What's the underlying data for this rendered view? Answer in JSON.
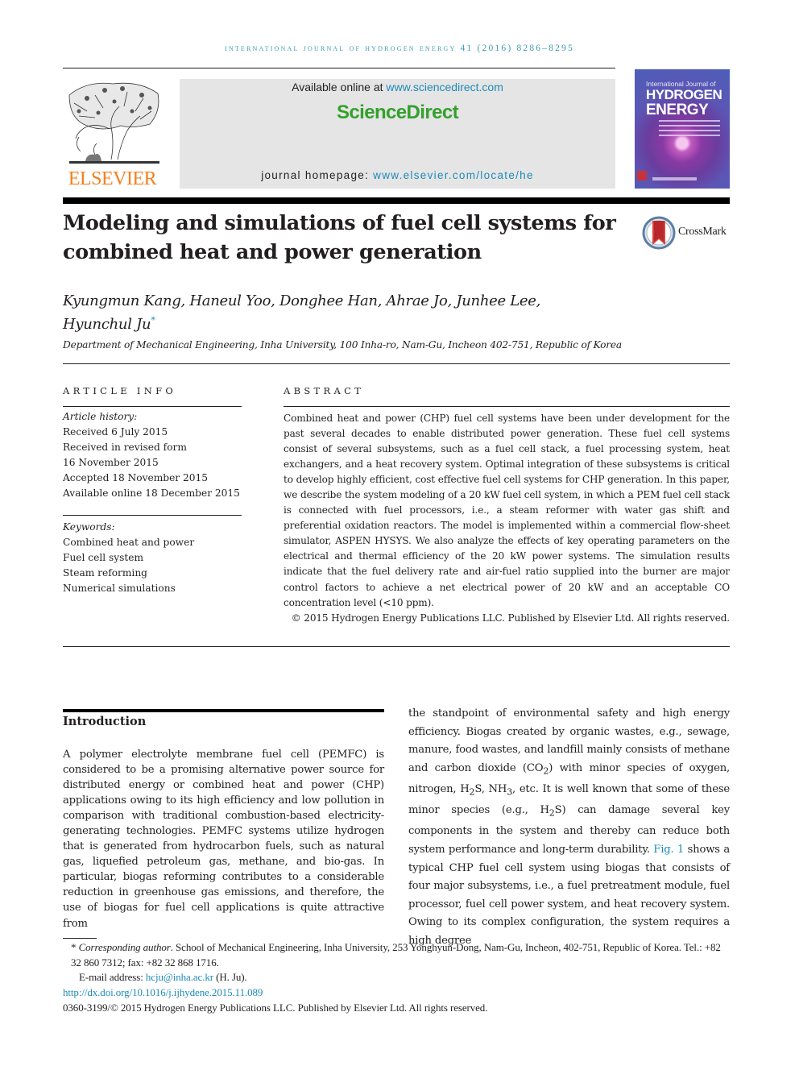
{
  "running_head": "International Journal of Hydrogen Energy 41 (2016) 8286–8295",
  "publisher": {
    "logo_word": "ELSEVIER",
    "available_prefix": "Available online at ",
    "available_link": "www.sciencedirect.com",
    "brand": "ScienceDirect",
    "homepage_prefix": "journal homepage: ",
    "homepage_link": "www.elsevier.com/locate/he"
  },
  "cover": {
    "small": "International Journal of",
    "line1": "HYDROGEN",
    "line2": "ENERGY"
  },
  "article": {
    "title": "Modeling and simulations of fuel cell systems for combined heat and power generation",
    "crossmark": "CrossMark",
    "authors_line1": "Kyungmun Kang, Haneul Yoo, Donghee Han, Ahrae Jo, Junhee Lee,",
    "authors_line2": "Hyunchul Ju",
    "corresponding_mark": "*",
    "affiliation": "Department of Mechanical Engineering, Inha University, 100 Inha-ro, Nam-Gu, Incheon 402-751, Republic of Korea"
  },
  "article_info": {
    "heading": "ARTICLE INFO",
    "history_label": "Article history:",
    "history": [
      "Received 6 July 2015",
      "Received in revised form",
      "16 November 2015",
      "Accepted 18 November 2015",
      "Available online 18 December 2015"
    ],
    "keywords_label": "Keywords:",
    "keywords": [
      "Combined heat and power",
      "Fuel cell system",
      "Steam reforming",
      "Numerical simulations"
    ]
  },
  "abstract": {
    "heading": "ABSTRACT",
    "text": "Combined heat and power (CHP) fuel cell systems have been under development for the past several decades to enable distributed power generation. These fuel cell systems consist of several subsystems, such as a fuel cell stack, a fuel processing system, heat exchangers, and a heat recovery system. Optimal integration of these subsystems is critical to develop highly efficient, cost effective fuel cell systems for CHP generation. In this paper, we describe the system modeling of a 20 kW fuel cell system, in which a PEM fuel cell stack is connected with fuel processors, i.e., a steam reformer with water gas shift and preferential oxidation reactors. The model is implemented within a commercial flow-sheet simulator, ASPEN HYSYS. We also analyze the effects of key operating parameters on the electrical and thermal efficiency of the 20 kW power systems. The simulation results indicate that the fuel delivery rate and air-fuel ratio supplied into the burner are major control factors to achieve a net electrical power of 20 kW and an acceptable CO concentration level (<10 ppm).",
    "copyright": "© 2015 Hydrogen Energy Publications LLC. Published by Elsevier Ltd. All rights reserved."
  },
  "introduction": {
    "heading": "Introduction",
    "left_text": "A polymer electrolyte membrane fuel cell (PEMFC) is considered to be a promising alternative power source for distributed energy or combined heat and power (CHP) applications owing to its high efficiency and low pollution in comparison with traditional combustion-based electricity-generating technologies. PEMFC systems utilize hydrogen that is generated from hydrocarbon fuels, such as natural gas, liquefied petroleum gas, methane, and bio-gas. In particular, biogas reforming contributes to a considerable reduction in greenhouse gas emissions, and therefore, the use of biogas for fuel cell applications is quite attractive from",
    "right_part1": "the standpoint of environmental safety and high energy efficiency. Biogas created by organic wastes, e.g., sewage, manure, food wastes, and landfill mainly consists of methane and carbon dioxide (CO",
    "right_sub1": "2",
    "right_part2": ") with minor species of oxygen, nitrogen, H",
    "right_sub2": "2",
    "right_part3": "S, NH",
    "right_sub3": "3",
    "right_part4": ", etc. It is well known that some of these minor species (e.g., H",
    "right_sub4": "2",
    "right_part5": "S) can damage several key components in the system and thereby can reduce both system performance and long-term durability. ",
    "fig_link": "Fig. 1",
    "right_part6": " shows a typical CHP fuel cell system using biogas that consists of four major subsystems, i.e., a fuel pretreatment module, fuel processor, fuel cell power system, and heat recovery system. Owing to its complex configuration, the system requires a high degree"
  },
  "footnotes": {
    "mark": "*",
    "corr_label": "Corresponding author",
    "corr_text": ". School of Mechanical Engineering, Inha University, 253 Yonghyun-Dong, Nam-Gu, Incheon, 402-751, Republic of Korea. Tel.: +82 32 860 7312; fax: +82 32 868 1716.",
    "email_label": "E-mail address: ",
    "email": "hcju@inha.ac.kr",
    "email_suffix": " (H. Ju).",
    "doi": "http://dx.doi.org/10.1016/j.ijhydene.2015.11.089",
    "issn_line": "0360-3199/© 2015 Hydrogen Energy Publications LLC. Published by Elsevier Ltd. All rights reserved."
  }
}
